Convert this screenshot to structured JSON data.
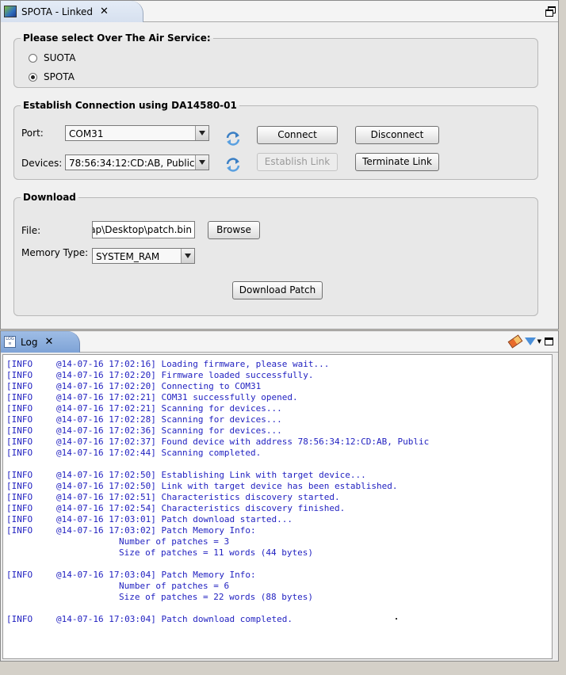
{
  "spota_view": {
    "tab_title": "SPOTA - Linked",
    "ota_group": {
      "legend": "Please select Over The Air Service:",
      "options": [
        {
          "label": "SUOTA",
          "selected": false
        },
        {
          "label": "SPOTA",
          "selected": true
        }
      ]
    },
    "connection_group": {
      "legend": "Establish Connection using DA14580-01",
      "port_label": "Port:",
      "port_value": "COM31",
      "devices_label": "Devices:",
      "devices_value": "78:56:34:12:CD:AB, Public",
      "connect_label": "Connect",
      "disconnect_label": "Disconnect",
      "establish_link_label": "Establish Link",
      "terminate_link_label": "Terminate Link"
    },
    "download_group": {
      "legend": "Download",
      "file_label": "File:",
      "file_value": "pap\\Desktop\\patch.bin",
      "browse_label": "Browse",
      "memory_type_label": "Memory Type:",
      "memory_type_value": "SYSTEM_RAM",
      "download_patch_label": "Download Patch"
    }
  },
  "log_view": {
    "tab_title": "Log",
    "lines": [
      {
        "level": "[INFO",
        "time": "@14-07-16 17:02:16]",
        "msg": "Loading firmware, please wait..."
      },
      {
        "level": "[INFO",
        "time": "@14-07-16 17:02:20]",
        "msg": "Firmware loaded successfully."
      },
      {
        "level": "[INFO",
        "time": "@14-07-16 17:02:20]",
        "msg": "Connecting to COM31"
      },
      {
        "level": "[INFO",
        "time": "@14-07-16 17:02:21]",
        "msg": "COM31 successfully opened."
      },
      {
        "level": "[INFO",
        "time": "@14-07-16 17:02:21]",
        "msg": "Scanning for devices..."
      },
      {
        "level": "[INFO",
        "time": "@14-07-16 17:02:28]",
        "msg": "Scanning for devices..."
      },
      {
        "level": "[INFO",
        "time": "@14-07-16 17:02:36]",
        "msg": "Scanning for devices..."
      },
      {
        "level": "[INFO",
        "time": "@14-07-16 17:02:37]",
        "msg": "Found device with address 78:56:34:12:CD:AB, Public"
      },
      {
        "level": "[INFO",
        "time": "@14-07-16 17:02:44]",
        "msg": "Scanning completed."
      },
      {
        "level": "[INFO",
        "time": "@14-07-16 17:02:50]",
        "msg": "Establishing Link with target device..."
      },
      {
        "level": "[INFO",
        "time": "@14-07-16 17:02:50]",
        "msg": "Link with target device has been established."
      },
      {
        "level": "[INFO",
        "time": "@14-07-16 17:02:51]",
        "msg": "Characteristics discovery started."
      },
      {
        "level": "[INFO",
        "time": "@14-07-16 17:02:54]",
        "msg": "Characteristics discovery finished."
      },
      {
        "level": "[INFO",
        "time": "@14-07-16 17:03:01]",
        "msg": "Patch download started..."
      },
      {
        "level": "[INFO",
        "time": "@14-07-16 17:03:02]",
        "msg": "Patch Memory Info:"
      },
      {
        "detail": "Number of patches = 3"
      },
      {
        "detail": "Size of patches = 11 words (44 bytes)"
      },
      {
        "level": "[INFO",
        "time": "@14-07-16 17:03:04]",
        "msg": "Patch Memory Info:"
      },
      {
        "detail": "Number of patches = 6"
      },
      {
        "detail": "Size of patches = 22 words (88 bytes)"
      },
      {
        "level": "[INFO",
        "time": "@14-07-16 17:03:04]",
        "msg": "Patch download completed."
      }
    ]
  },
  "colors": {
    "log_text": "#1f1fc0",
    "log_tab": "#7ea3d6"
  }
}
